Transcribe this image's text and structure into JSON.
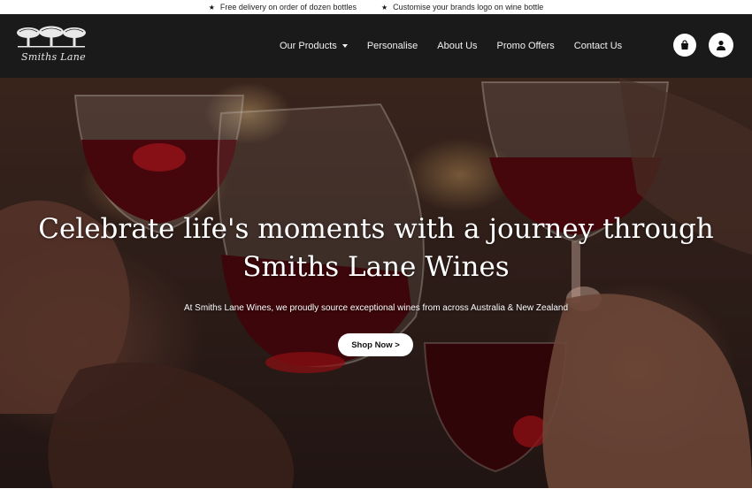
{
  "announcement": {
    "items": [
      {
        "icon": "star-icon",
        "text": "Free delivery on order of dozen bottles"
      },
      {
        "icon": "star-icon",
        "text": "Customise your brands logo on wine bottle"
      }
    ]
  },
  "brand": {
    "name": "Smiths Lane"
  },
  "nav": {
    "items": [
      {
        "label": "Our Products",
        "has_dropdown": true
      },
      {
        "label": "Personalise"
      },
      {
        "label": "About Us"
      },
      {
        "label": "Promo Offers"
      },
      {
        "label": "Contact Us"
      }
    ]
  },
  "header_icons": {
    "cart": "shopping-bag-icon",
    "account": "user-icon"
  },
  "hero": {
    "title_line1": "Celebrate life's moments with a journey through",
    "title_line2": "Smiths Lane Wines",
    "subtitle": "At Smiths Lane Wines, we proudly source exceptional wines from across Australia & New Zealand",
    "cta_label": "Shop Now >"
  },
  "colors": {
    "header_bg": "#1a1a1a",
    "nav_text": "#f2f2f2",
    "hero_text": "#ffffff",
    "cta_bg": "#ffffff",
    "wine": "#7a0f14"
  }
}
